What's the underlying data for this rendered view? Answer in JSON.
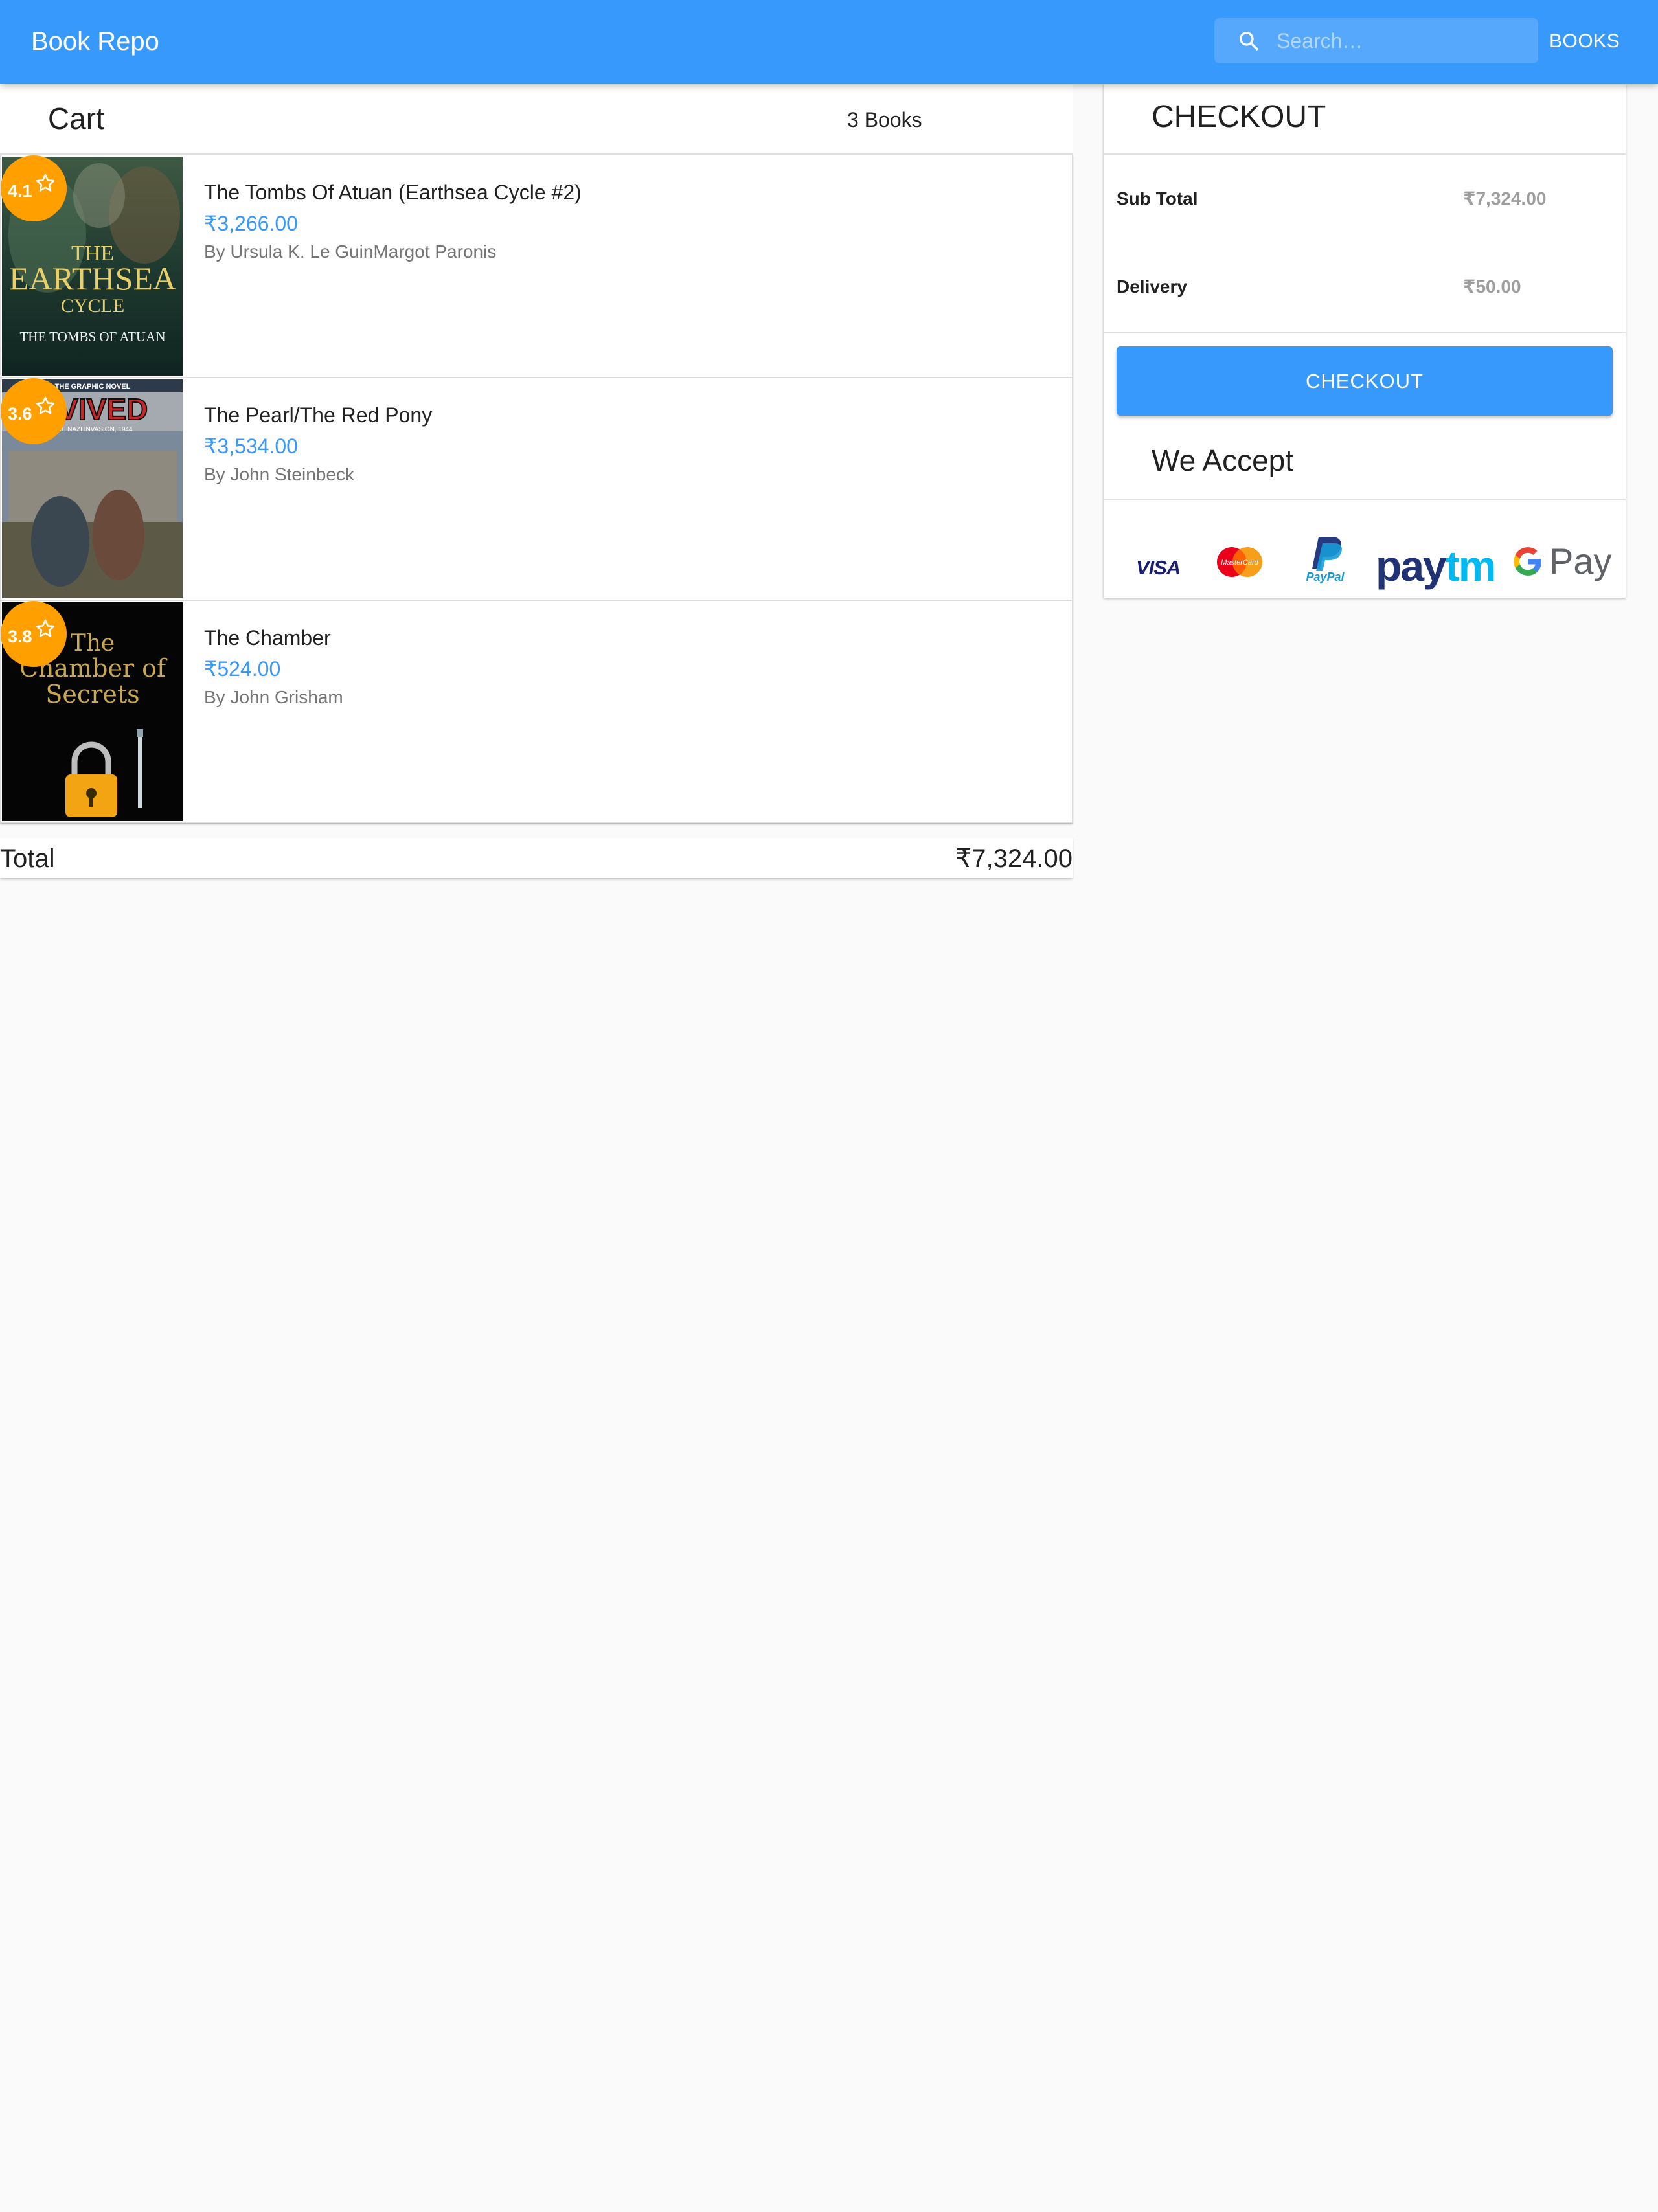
{
  "app": {
    "title": "Book Repo"
  },
  "search": {
    "placeholder": "Search…",
    "value": ""
  },
  "nav": {
    "books_link": "BOOKS"
  },
  "cart": {
    "title": "Cart",
    "count_label": "3 Books",
    "items": [
      {
        "rating": "4.1",
        "title": "The Tombs Of Atuan (Earthsea Cycle #2)",
        "price": "₹3,266.00",
        "author": "By Ursula K. Le GuinMargot Paronis",
        "cover_text": [
          "THE",
          "EARTHSEA",
          "CYCLE",
          "THE TOMBS OF ATUAN"
        ]
      },
      {
        "rating": "3.6",
        "title": "The Pearl/The Red Pony",
        "price": "₹3,534.00",
        "author": "By John Steinbeck",
        "cover_text": [
          "THE GRAPHIC NOVEL",
          "RVIVED",
          "THE NAZI INVASION, 1944"
        ]
      },
      {
        "rating": "3.8",
        "title": "The Chamber",
        "price": "₹524.00",
        "author": "By John Grisham",
        "cover_text": [
          "The",
          "Chamber of",
          "Secrets"
        ]
      }
    ],
    "total_label": "Total",
    "total_value": "₹7,324.00"
  },
  "checkout": {
    "title": "CHECKOUT",
    "subtotal_label": "Sub Total",
    "subtotal_value": "₹7,324.00",
    "delivery_label": "Delivery",
    "delivery_value": "₹50.00",
    "button_label": "CHECKOUT",
    "accept_title": "We Accept",
    "payment_methods": {
      "visa": "VISA",
      "mastercard": "MasterCard",
      "paypal": "PayPal",
      "paytm_pay": "pay",
      "paytm_tm": "tm",
      "gpay": "Pay"
    }
  },
  "colors": {
    "primary": "#3899fc",
    "rating_badge": "#ffa000",
    "background": "#fafafa"
  },
  "icons": {
    "search": "search-icon",
    "star": "star-outline-icon"
  }
}
